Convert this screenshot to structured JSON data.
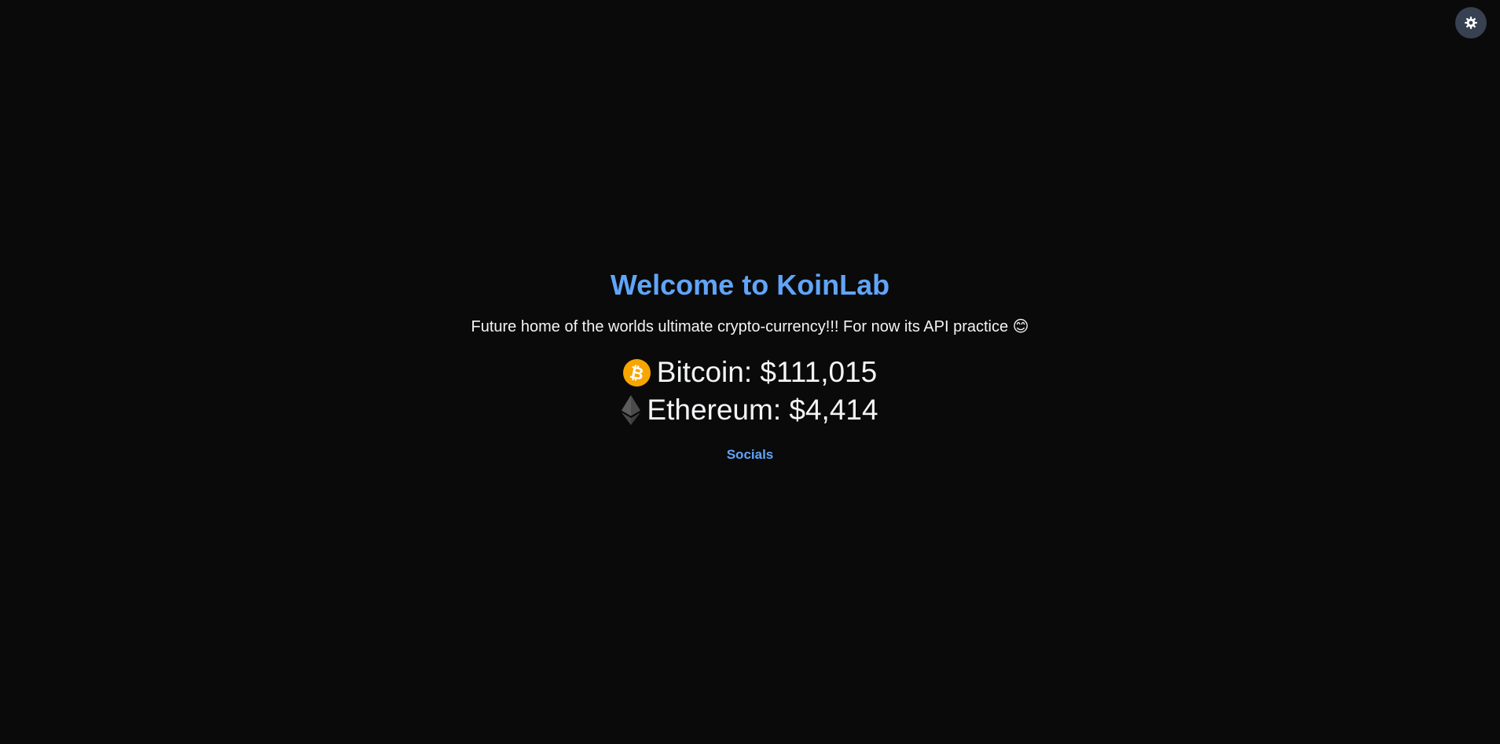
{
  "header": {
    "theme_toggle_icon": "gear-icon"
  },
  "main": {
    "title": "Welcome to KoinLab",
    "subtitle": "Future home of the worlds ultimate crypto-currency!!! For now its API practice 😊",
    "prices": [
      {
        "icon": "bitcoin-icon",
        "label": "Bitcoin: $111,015"
      },
      {
        "icon": "ethereum-icon",
        "label": "Ethereum: $4,414"
      }
    ],
    "socials_label": "Socials"
  },
  "colors": {
    "background": "#0a0a0a",
    "accent": "#60a5fa",
    "text": "#f3f4f6",
    "bitcoin": "#f7a600",
    "toggle_bg": "#374151"
  }
}
